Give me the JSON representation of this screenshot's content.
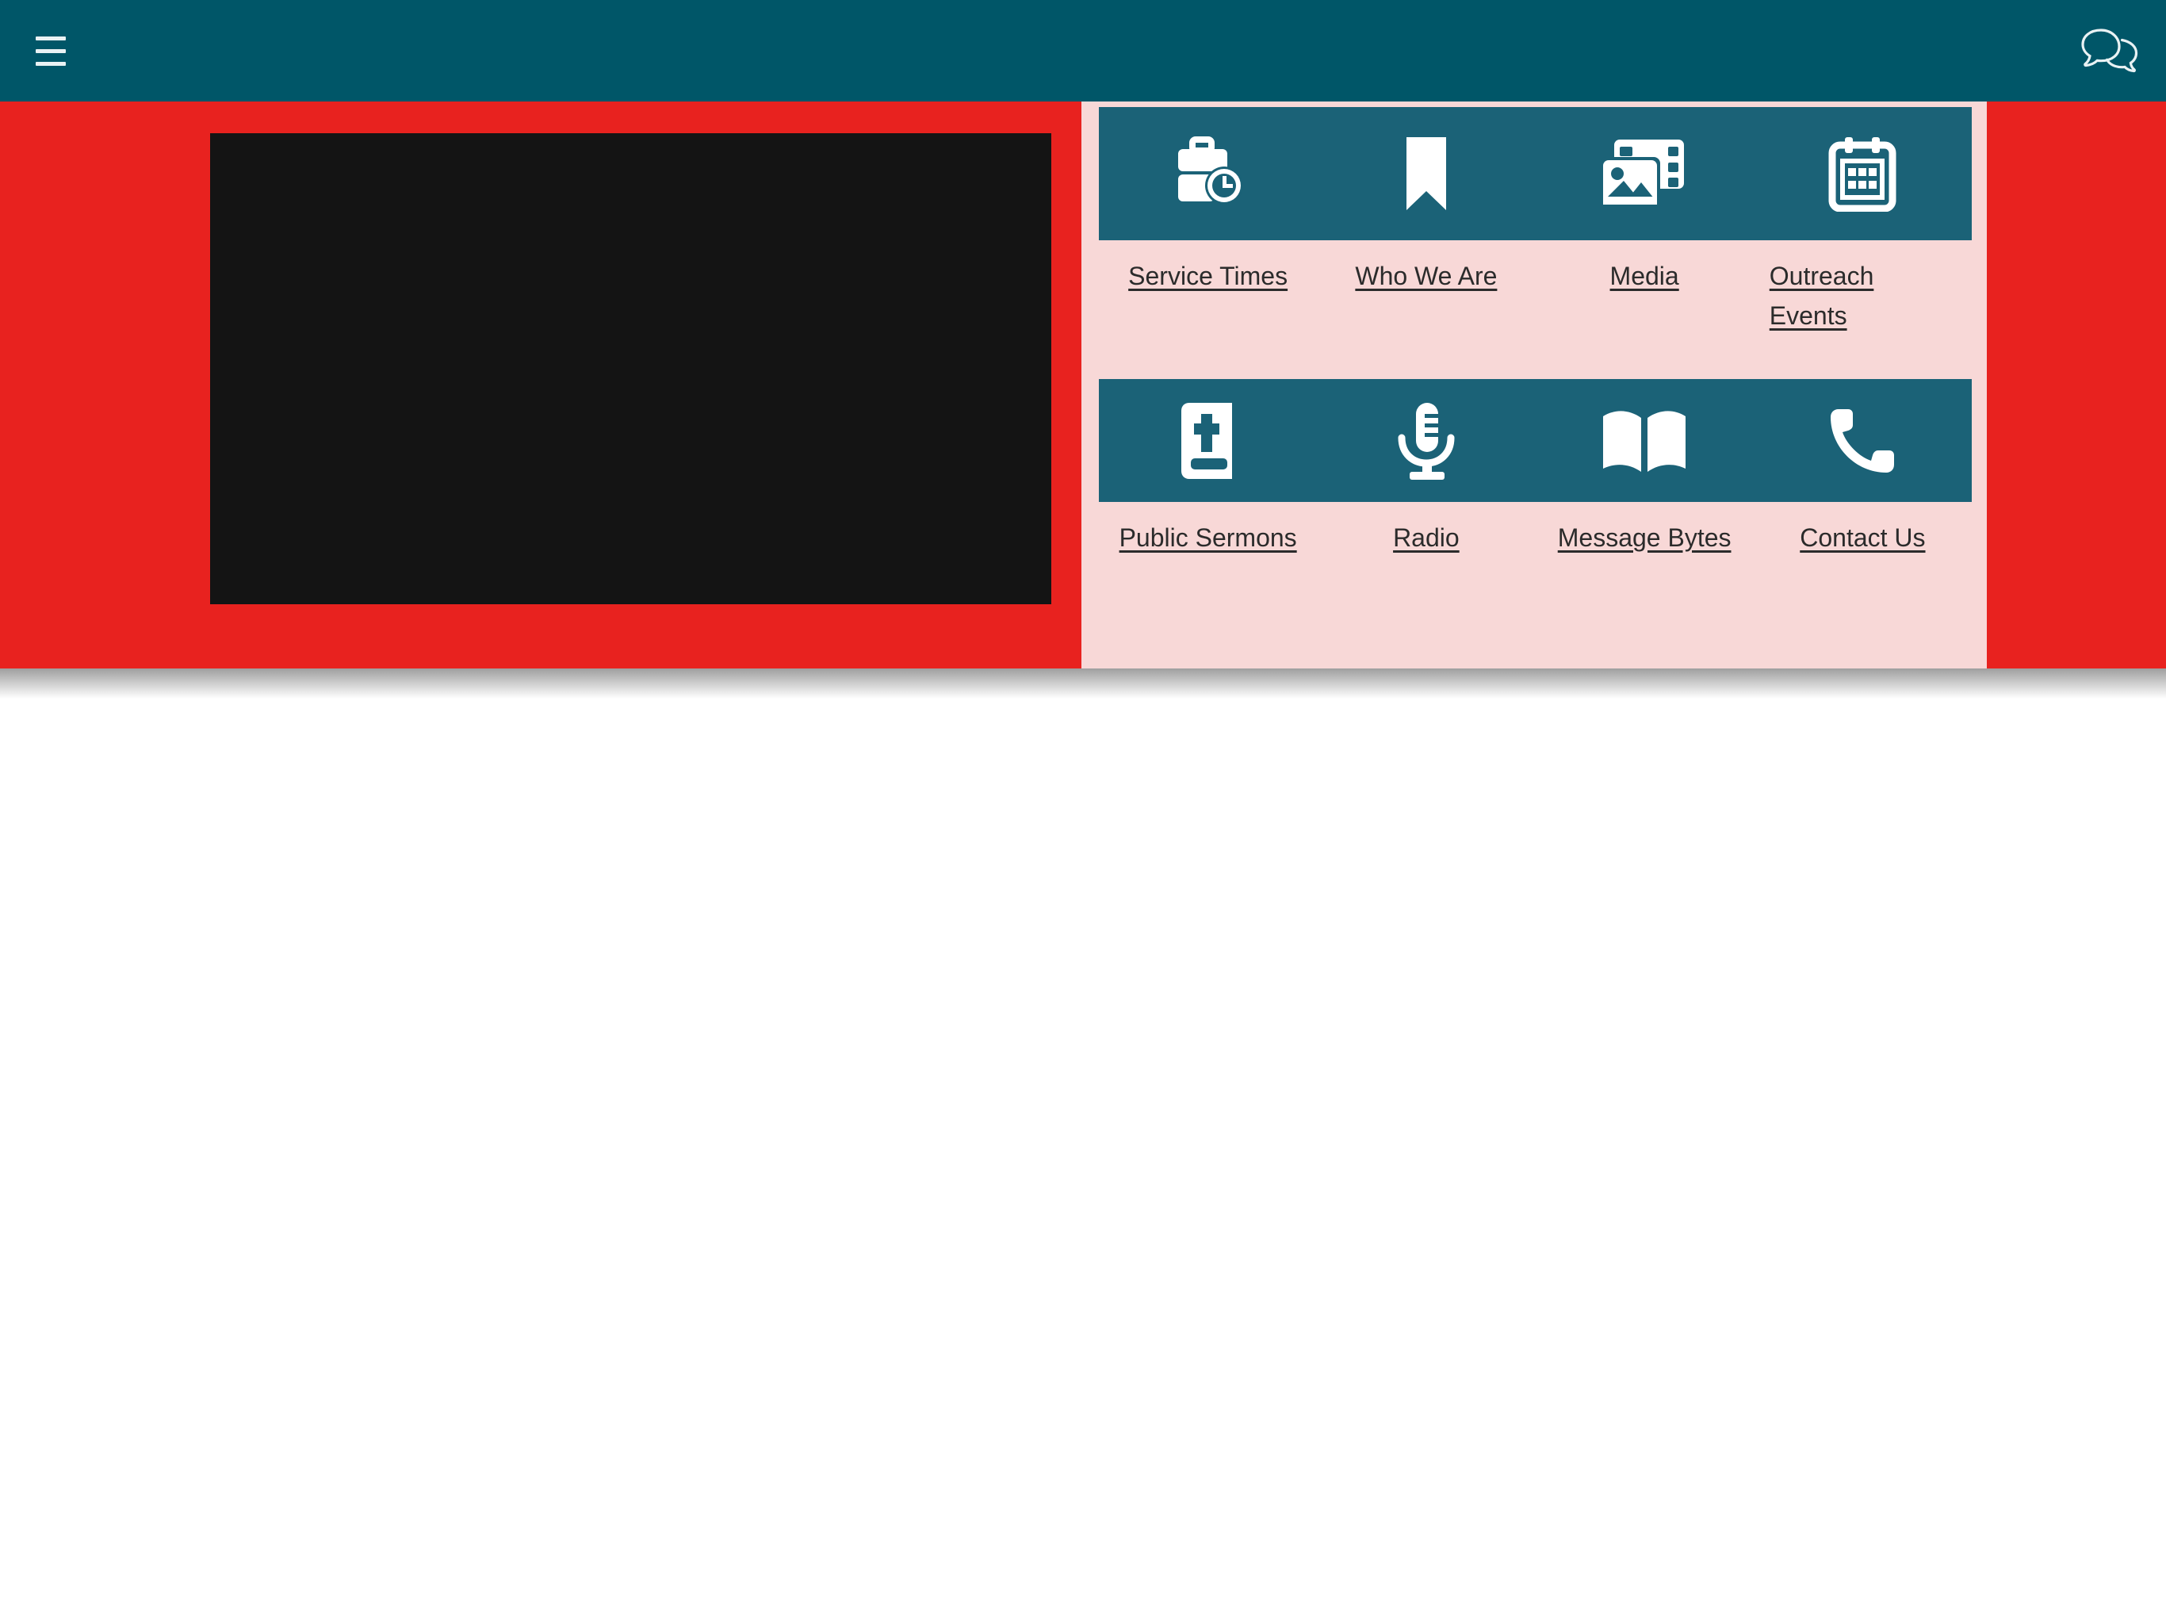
{
  "topbar": {
    "background_color": "#005668",
    "menu_button": {
      "name": "Menu",
      "icon": "hamburger-icon"
    },
    "chat_button": {
      "name": "Chat",
      "icon": "comments-icon"
    }
  },
  "hero": {
    "background_color": "#e8221f",
    "video": {
      "label": "Video player",
      "state": "blank",
      "background_color": "#141414"
    }
  },
  "quicklinks": {
    "panel_color": "#f8d8d7",
    "tile_color": "#1b6277",
    "rows": [
      {
        "items": [
          {
            "icon": "briefcase-clock-icon",
            "label": "Service Times"
          },
          {
            "icon": "bookmark-icon",
            "label": "Who We Are"
          },
          {
            "icon": "photos-icon",
            "label": "Media"
          },
          {
            "icon": "calendar-icon",
            "label": "Outreach Events"
          }
        ]
      },
      {
        "items": [
          {
            "icon": "bible-icon",
            "label": "Public Sermons"
          },
          {
            "icon": "microphone-icon",
            "label": "Radio"
          },
          {
            "icon": "open-book-icon",
            "label": "Message Bytes"
          },
          {
            "icon": "phone-icon",
            "label": "Contact Us"
          }
        ]
      }
    ]
  }
}
